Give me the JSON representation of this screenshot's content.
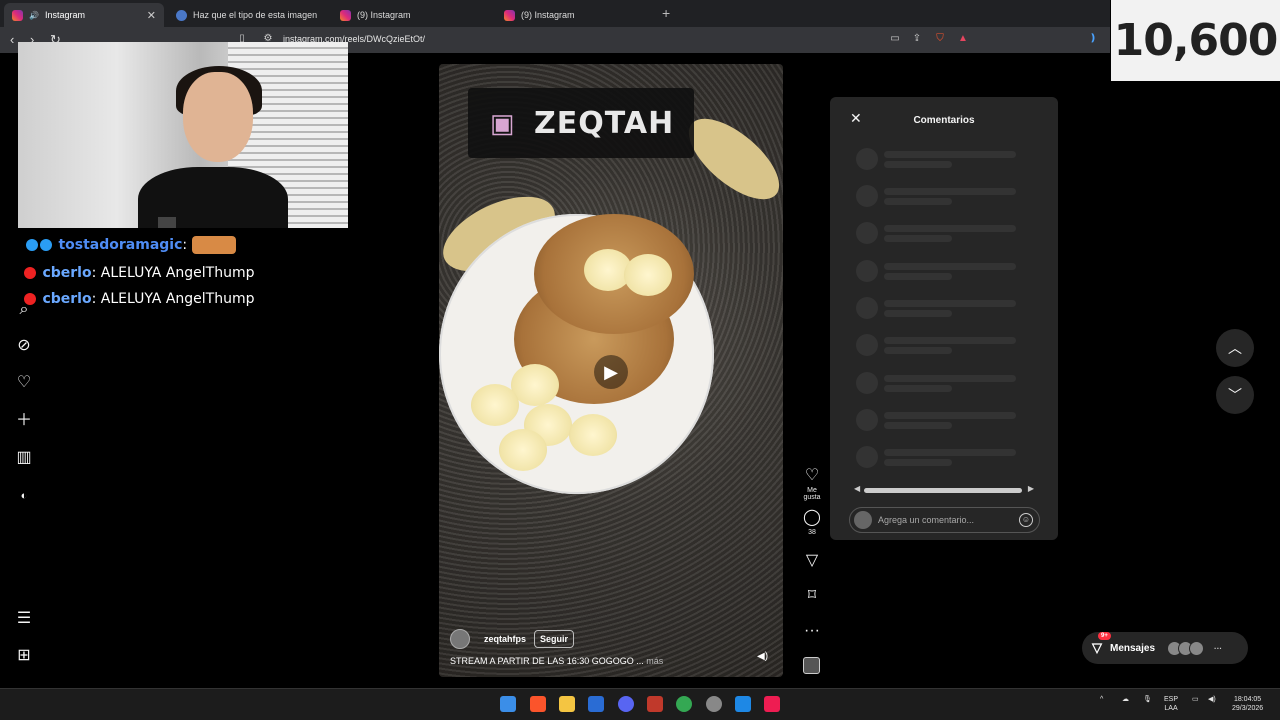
{
  "browser": {
    "tabs": [
      {
        "label": "Instagram",
        "active": true,
        "close": "✕"
      },
      {
        "label": "Haz que el tipo de esta imagen digε",
        "active": false
      },
      {
        "label": "(9) Instagram",
        "active": false
      },
      {
        "label": "(9) Instagram",
        "active": false
      }
    ],
    "new_tab": "+",
    "url": "instagram.com/reels/DWcQzieEtOt/"
  },
  "counter": "10,600",
  "chat": {
    "lines": [
      {
        "user": "tostadoramagic",
        "message": ":"
      },
      {
        "user": "cberlo",
        "message": ": ALELUYA AngelThump"
      },
      {
        "user": "cberlo",
        "message": ": ALELUYA AngelThump"
      }
    ]
  },
  "sidebar": {
    "icons": [
      "reels-icon",
      "messages-icon",
      "search-icon",
      "explore-icon",
      "notifications-icon",
      "create-icon",
      "dashboard-icon",
      "profile-icon",
      "menu-icon",
      "more-icon"
    ]
  },
  "reel": {
    "overlay_channel": "ZEQTAH",
    "author": "zeqtahfps",
    "follow_label": "Seguir",
    "caption": "STREAM A PARTIR DE LAS 16:30 GOGOGO ...",
    "caption_more": "más"
  },
  "actions": {
    "like_label": "Me gusta",
    "comment_count": "38"
  },
  "comments": {
    "title": "Comentarios",
    "input_placeholder": "Agrega un comentario..."
  },
  "messages": {
    "label": "Mensajes",
    "badge": "9+"
  },
  "taskbar": {
    "lang": "ESP",
    "lang2": "LAA",
    "time": "18:04:05",
    "date": "29/3/2026"
  }
}
